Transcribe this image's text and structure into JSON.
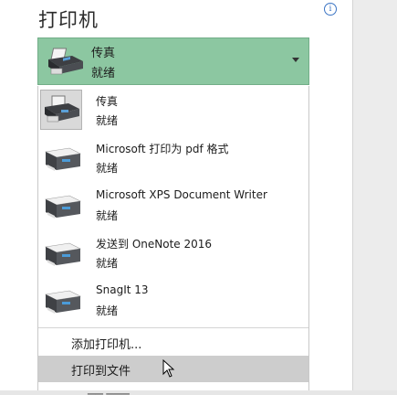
{
  "header": {
    "title": "打印机",
    "info_icon": "info-icon"
  },
  "selected": {
    "name": "传真",
    "status": "就绪"
  },
  "printers": [
    {
      "name": "传真",
      "status": "就绪",
      "icon": "fax-printer-icon"
    },
    {
      "name": "Microsoft 打印为 pdf 格式",
      "status": "就绪",
      "icon": "printer-icon"
    },
    {
      "name": "Microsoft XPS Document Writer",
      "status": "就绪",
      "icon": "printer-icon"
    },
    {
      "name": "发送到 OneNote 2016",
      "status": "就绪",
      "icon": "printer-icon"
    },
    {
      "name": "SnagIt 13",
      "status": "就绪",
      "icon": "printer-icon"
    }
  ],
  "actions": {
    "add_printer": "添加打印机...",
    "print_to_file": "打印到文件"
  },
  "colors": {
    "selector_bg": "#8cc7a1",
    "hover_bg": "#cdcdcd",
    "accent": "#3b74c4"
  }
}
